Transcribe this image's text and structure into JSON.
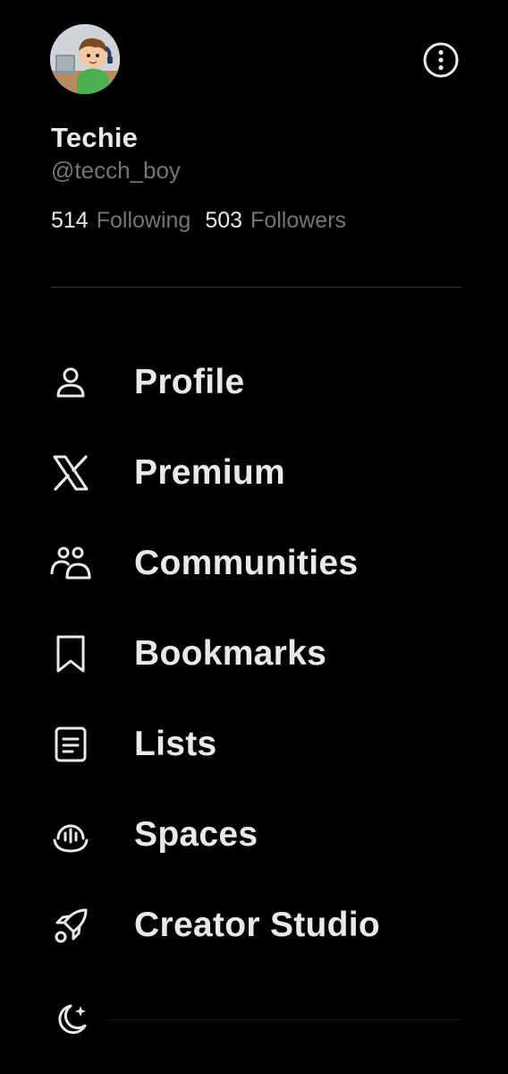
{
  "profile": {
    "display_name": "Techie",
    "handle": "@tecch_boy",
    "following_count": "514",
    "following_label": "Following",
    "followers_count": "503",
    "followers_label": "Followers"
  },
  "menu": {
    "items": [
      {
        "label": "Profile",
        "icon": "person-icon"
      },
      {
        "label": "Premium",
        "icon": "x-logo-icon"
      },
      {
        "label": "Communities",
        "icon": "communities-icon"
      },
      {
        "label": "Bookmarks",
        "icon": "bookmark-icon"
      },
      {
        "label": "Lists",
        "icon": "list-icon"
      },
      {
        "label": "Spaces",
        "icon": "spaces-icon"
      },
      {
        "label": "Creator Studio",
        "icon": "rocket-icon"
      }
    ]
  },
  "footer": {
    "theme_icon": "moon-sparkle-icon"
  },
  "colors": {
    "background": "#000000",
    "primary_text": "#e7e9ea",
    "secondary_text": "#71767b",
    "divider": "#2f3336"
  }
}
